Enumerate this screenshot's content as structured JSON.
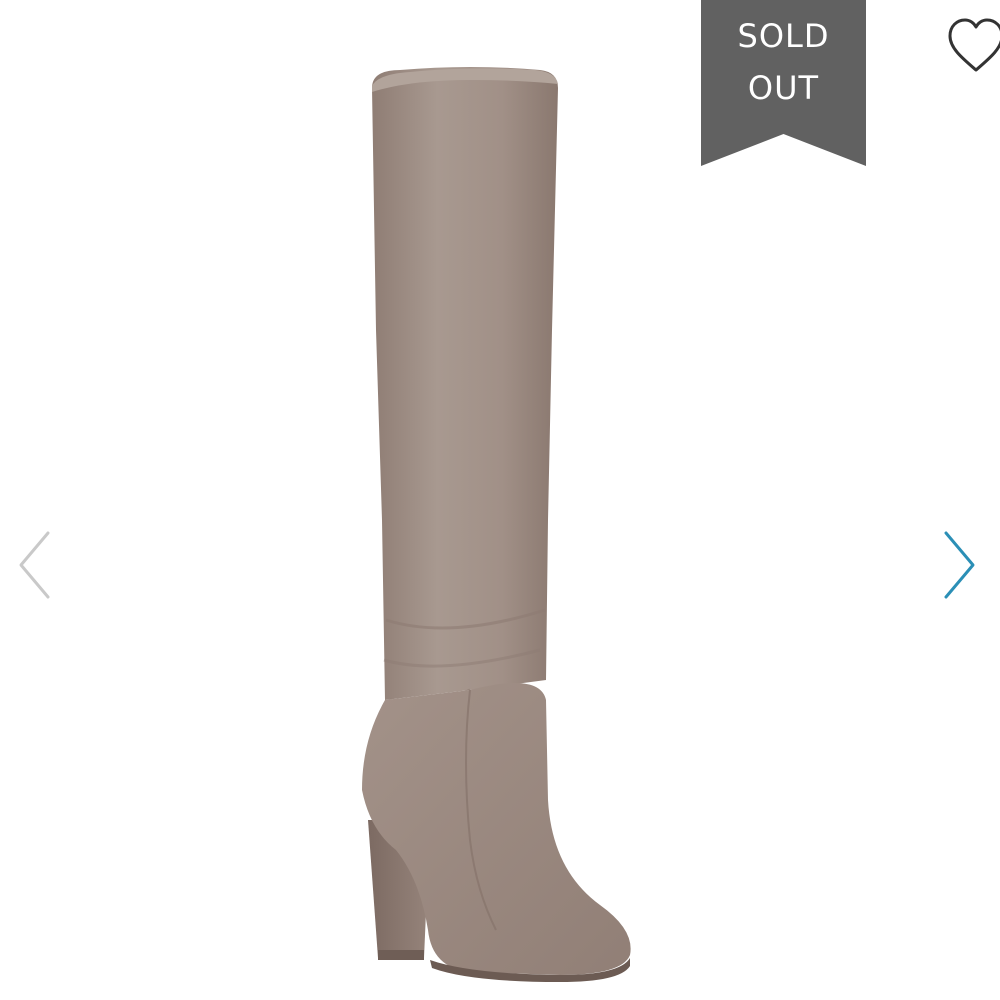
{
  "badge": {
    "line1": "SOLD",
    "line2": "OUT",
    "color": "#616161"
  },
  "icons": {
    "favorite": "heart-outline-icon",
    "previous": "chevron-left-icon",
    "next": "chevron-right-icon"
  },
  "colors": {
    "prev_arrow": "#c9c9c9",
    "next_arrow": "#2b8fb6",
    "heart": "#333333",
    "boot_suede": "#9d8b82"
  }
}
